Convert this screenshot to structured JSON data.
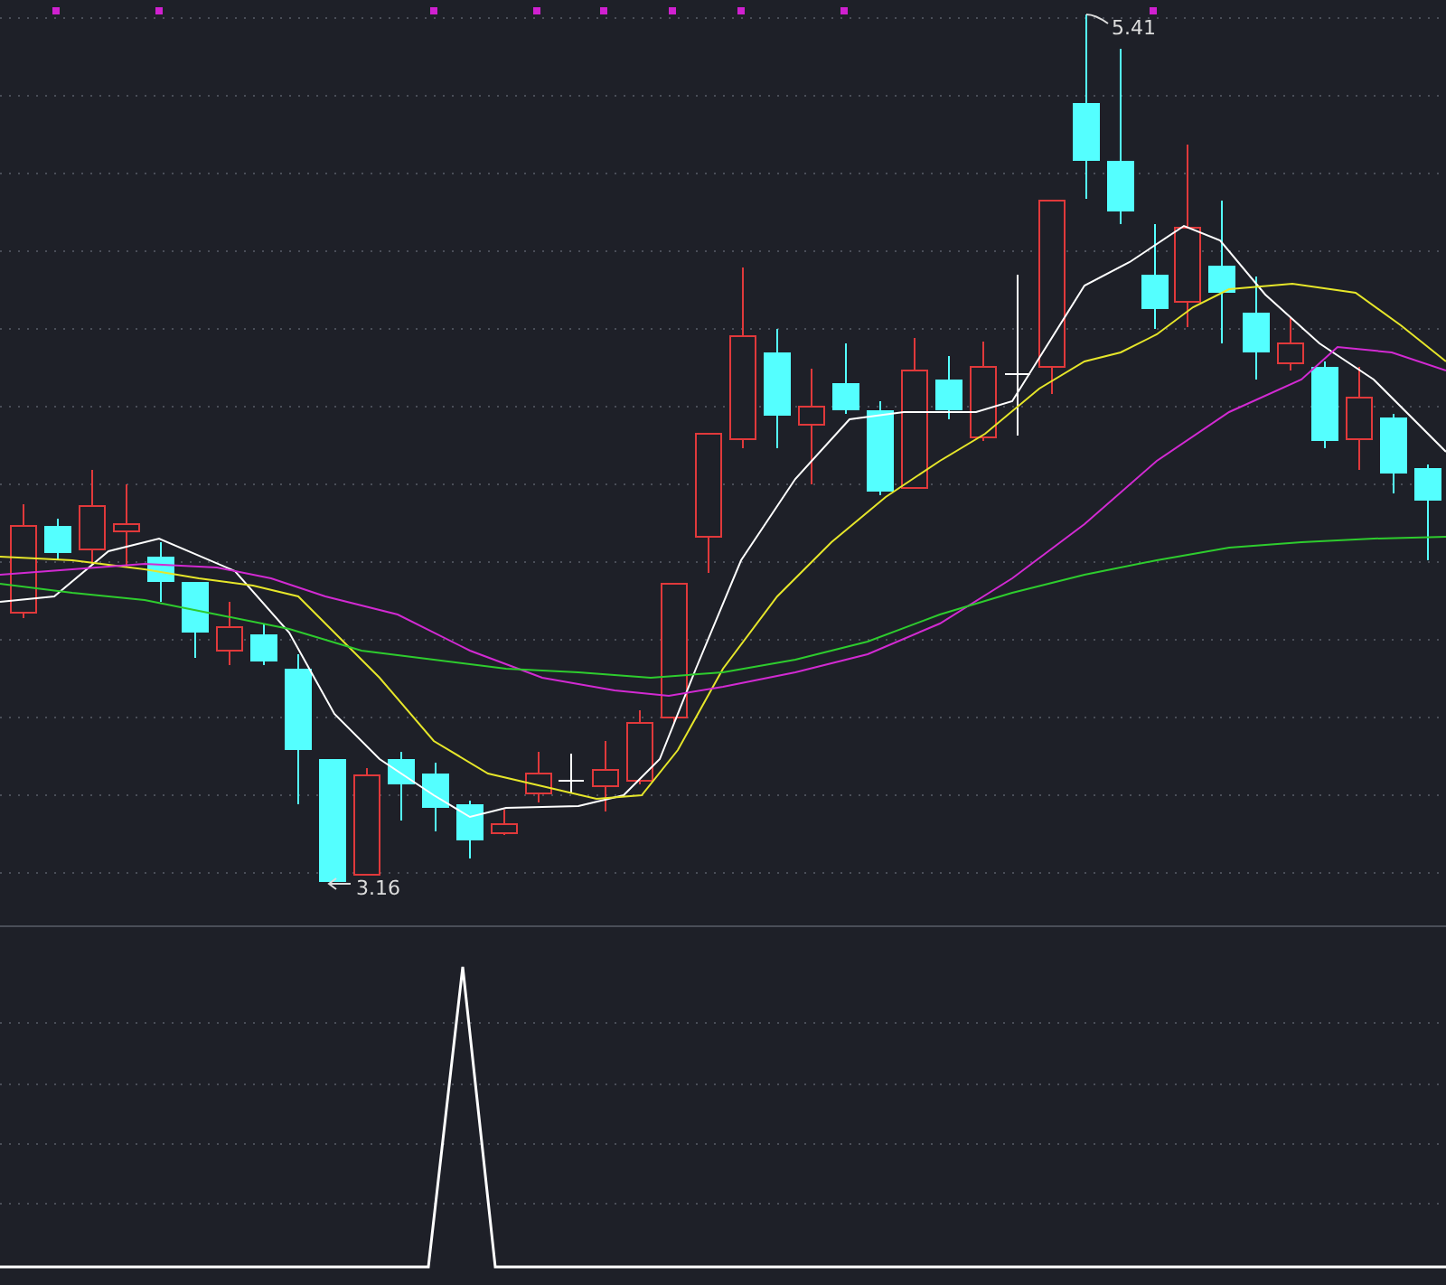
{
  "price_panel": {
    "high_label": "5.41",
    "low_label": "3.16"
  }
}
